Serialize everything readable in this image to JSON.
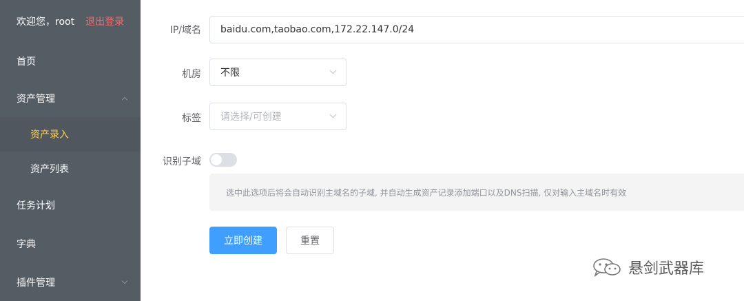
{
  "sidebar": {
    "welcome": "欢迎您，root",
    "logout": "退出登录",
    "items": [
      {
        "label": "首页"
      },
      {
        "label": "资产管理",
        "expanded": true
      },
      {
        "label": "资产录入",
        "active": true
      },
      {
        "label": "资产列表"
      },
      {
        "label": "任务计划"
      },
      {
        "label": "字典"
      },
      {
        "label": "插件管理",
        "expanded": false
      }
    ]
  },
  "form": {
    "target": {
      "label": "IP/域名",
      "value": "baidu.com,taobao.com,172.22.147.0/24"
    },
    "room": {
      "label": "机房",
      "value": "不限"
    },
    "tag": {
      "label": "标签",
      "placeholder": "请选择/可创建"
    },
    "subdomain": {
      "label": "识别子域",
      "enabled": false,
      "hint": "选中此选项后将会自动识别主域名的子域, 并自动生成资产记录添加端口以及DNS扫描, 仅对输入主域名时有效"
    },
    "submit_label": "立即创建",
    "reset_label": "重置"
  },
  "watermark": {
    "text": "悬剑武器库",
    "icon": "wechat-icon"
  },
  "colors": {
    "sidebar_bg": "#545c64",
    "active_text": "#ffd04b",
    "logout": "#f56c6c",
    "primary": "#409eff"
  }
}
